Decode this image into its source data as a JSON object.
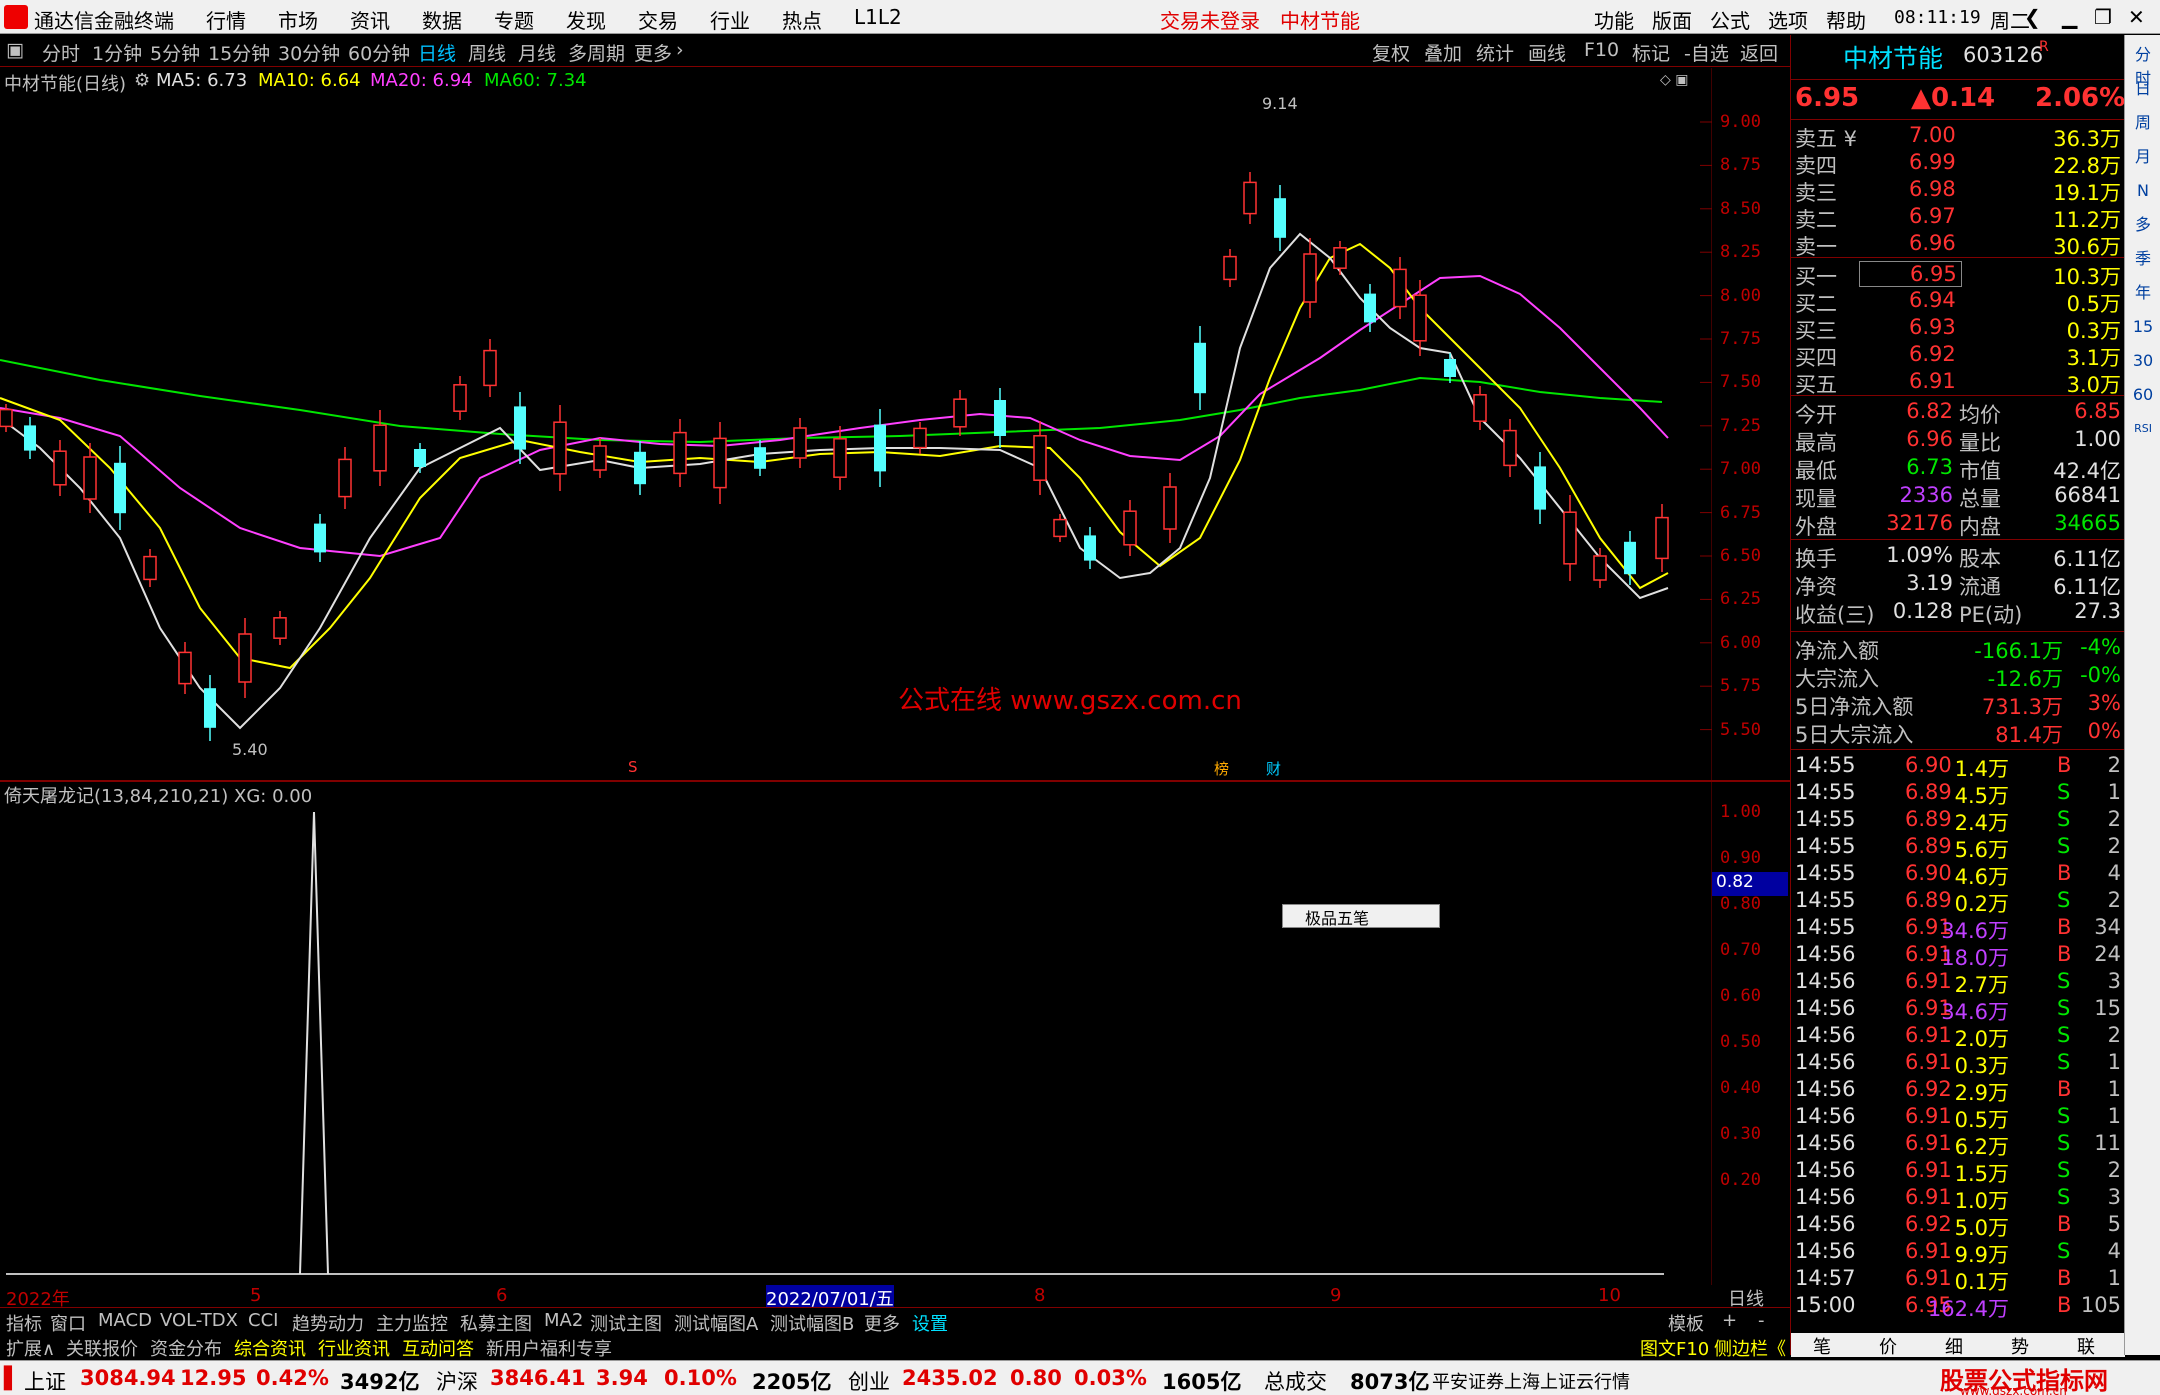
{
  "menubar": {
    "app_title": "通达信金融终端",
    "items": [
      "行情",
      "市场",
      "资讯",
      "数据",
      "专题",
      "发现",
      "交易",
      "行业",
      "热点",
      "L1L2"
    ],
    "status_login": "交易未登录",
    "stock_title": "中材节能",
    "right_items": [
      "功能",
      "版面",
      "公式",
      "选项",
      "帮助"
    ],
    "time": "08:11:19",
    "weekday": "周二"
  },
  "toolbar": {
    "periods": [
      "分时",
      "1分钟",
      "5分钟",
      "15分钟",
      "30分钟",
      "60分钟",
      "日线",
      "周线",
      "月线",
      "多周期",
      "更多"
    ],
    "active": "日线",
    "right": [
      "复权",
      "叠加",
      "统计",
      "画线",
      "F10",
      "标记",
      "-自选",
      "返回"
    ]
  },
  "main_chart": {
    "title": "中材节能(日线)",
    "ma5": "MA5: 6.73",
    "ma10": "MA10: 6.64",
    "ma20": "MA20: 6.94",
    "ma60": "MA60: 7.34",
    "high_label": "9.14",
    "low_label": "5.40",
    "y_ticks": [
      "9.00",
      "8.75",
      "8.50",
      "8.25",
      "8.00",
      "7.75",
      "7.50",
      "7.25",
      "7.00",
      "6.75",
      "6.50",
      "6.25",
      "6.00",
      "5.75",
      "5.50"
    ],
    "marker_s": "S",
    "marker_b": "榜",
    "marker_c": "财"
  },
  "sub_chart": {
    "title": "倚天屠龙记(13,84,210,21)  XG: 0.00",
    "y_ticks": [
      "1.00",
      "0.90",
      "0.80",
      "0.70",
      "0.60",
      "0.50",
      "0.40",
      "0.30",
      "0.20"
    ],
    "cursor_value": "0.82"
  },
  "watermark": "公式在线  www.gszx.com.cn",
  "ime": "极品五笔",
  "xaxis": {
    "labels": [
      "2022年",
      "5",
      "6",
      "2022/07/01/五",
      "8",
      "9",
      "10"
    ],
    "period": "日线"
  },
  "tabs1": [
    "指标",
    "窗口",
    "MACD",
    "VOL-TDX",
    "CCI",
    "趋势动力",
    "主力监控",
    "私募主图",
    "MA2",
    "测试主图",
    "测试幅图A",
    "测试幅图B",
    "更多",
    "设置"
  ],
  "tabs1_right": [
    "模板",
    "+",
    "-"
  ],
  "tabs2": [
    "扩展∧",
    "关联报价",
    "资金分布",
    "综合资讯",
    "行业资讯",
    "互动问答",
    "新用户福利专享"
  ],
  "tabs2_right": [
    "图文F10",
    "侧边栏《"
  ],
  "rpanel": {
    "name": "中材节能",
    "code": "603126",
    "r": "R",
    "price": "6.95",
    "change": "▲0.14",
    "pct": "2.06%",
    "asks": [
      {
        "label": "卖五 ¥",
        "p": "7.00",
        "v": "36.3万"
      },
      {
        "label": "卖四",
        "p": "6.99",
        "v": "22.8万"
      },
      {
        "label": "卖三",
        "p": "6.98",
        "v": "19.1万"
      },
      {
        "label": "卖二",
        "p": "6.97",
        "v": "11.2万"
      },
      {
        "label": "卖一",
        "p": "6.96",
        "v": "30.6万"
      }
    ],
    "bids": [
      {
        "label": "买一",
        "p": "6.95",
        "v": "10.3万"
      },
      {
        "label": "买二",
        "p": "6.94",
        "v": "0.5万"
      },
      {
        "label": "买三",
        "p": "6.93",
        "v": "0.3万"
      },
      {
        "label": "买四",
        "p": "6.92",
        "v": "3.1万"
      },
      {
        "label": "买五",
        "p": "6.91",
        "v": "3.0万"
      }
    ],
    "stats1": [
      [
        "今开",
        "6.82",
        "均价",
        "6.85"
      ],
      [
        "最高",
        "6.96",
        "量比",
        "1.00"
      ],
      [
        "最低",
        "6.73",
        "市值",
        "42.4亿"
      ],
      [
        "现量",
        "2336",
        "总量",
        "66841"
      ],
      [
        "外盘",
        "32176",
        "内盘",
        "34665"
      ]
    ],
    "stats2": [
      [
        "换手",
        "1.09%",
        "股本",
        "6.11亿"
      ],
      [
        "净资",
        "3.19",
        "流通",
        "6.11亿"
      ],
      [
        "收益(三)",
        "0.128",
        "PE(动)",
        "27.3"
      ]
    ],
    "flows": [
      [
        "净流入额",
        "-166.1万",
        "-4%"
      ],
      [
        "大宗流入",
        "-12.6万",
        "-0%"
      ],
      [
        "5日净流入额",
        "731.3万",
        "3%"
      ],
      [
        "5日大宗流入",
        "81.4万",
        "0%"
      ]
    ],
    "ticks": [
      [
        "14:55",
        "6.90",
        "1.4万",
        "B",
        "2"
      ],
      [
        "14:55",
        "6.89",
        "4.5万",
        "S",
        "1"
      ],
      [
        "14:55",
        "6.89",
        "2.4万",
        "S",
        "2"
      ],
      [
        "14:55",
        "6.89",
        "5.6万",
        "S",
        "2"
      ],
      [
        "14:55",
        "6.90",
        "4.6万",
        "B",
        "4"
      ],
      [
        "14:55",
        "6.89",
        "0.2万",
        "S",
        "2"
      ],
      [
        "14:55",
        "6.91",
        "34.6万",
        "B",
        "34"
      ],
      [
        "14:56",
        "6.91",
        "18.0万",
        "B",
        "24"
      ],
      [
        "14:56",
        "6.91",
        "2.7万",
        "S",
        "3"
      ],
      [
        "14:56",
        "6.91",
        "34.6万",
        "S",
        "15"
      ],
      [
        "14:56",
        "6.91",
        "2.0万",
        "S",
        "2"
      ],
      [
        "14:56",
        "6.91",
        "0.3万",
        "S",
        "1"
      ],
      [
        "14:56",
        "6.92",
        "2.9万",
        "B",
        "1"
      ],
      [
        "14:56",
        "6.91",
        "0.5万",
        "S",
        "1"
      ],
      [
        "14:56",
        "6.91",
        "6.2万",
        "S",
        "11"
      ],
      [
        "14:56",
        "6.91",
        "1.5万",
        "S",
        "2"
      ],
      [
        "14:56",
        "6.91",
        "1.0万",
        "S",
        "3"
      ],
      [
        "14:56",
        "6.92",
        "5.0万",
        "B",
        "5"
      ],
      [
        "14:56",
        "6.91",
        "9.9万",
        "S",
        "4"
      ],
      [
        "14:57",
        "6.91",
        "0.1万",
        "B",
        "1"
      ],
      [
        "15:00",
        "6.95",
        "162.4万",
        "B",
        "105"
      ]
    ],
    "bottom_tabs": [
      "笔",
      "价",
      "细",
      "势",
      "联"
    ]
  },
  "sidebar_icons": [
    "分时",
    "日",
    "周",
    "月",
    "N",
    "多",
    "季",
    "年",
    "15",
    "30",
    "60",
    "RSI"
  ],
  "statusbar": {
    "sh_label": "上证",
    "sh": "3084.94",
    "sh_chg": "12.95",
    "sh_pct": "0.42%",
    "sh_amt": "3492亿",
    "hs_label": "沪深",
    "hs": "3846.41",
    "hs_chg": "3.94",
    "hs_pct": "0.10%",
    "hs_amt": "2205亿",
    "cy_label": "创业",
    "cy": "2435.02",
    "cy_chg": "0.80",
    "cy_pct": "0.03%",
    "cy_amt": "1605亿",
    "total_label": "总成交",
    "total": "8073亿",
    "broker": "平安证券上海上证云行情",
    "brand": "股票公式指标网",
    "brand_url": "www.gszx.com.cn"
  }
}
